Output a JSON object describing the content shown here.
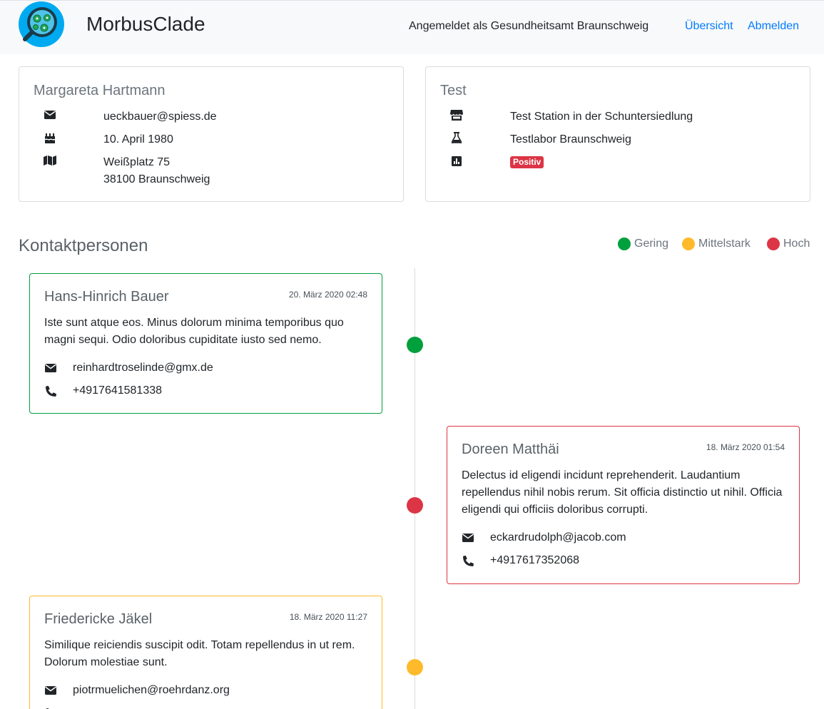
{
  "header": {
    "brand": "MorbusClade",
    "logged_in_text": "Angemeldet als Gesundheitsamt Braunschweig",
    "nav": {
      "overview": "Übersicht",
      "logout": "Abmelden"
    }
  },
  "colors": {
    "low": "#00a03c",
    "medium": "#ffba2b",
    "high": "#dc3545",
    "link": "#007bff"
  },
  "patient": {
    "name": "Margareta Hartmann",
    "email": "ueckbauer@spiess.de",
    "birthday": "10. April 1980",
    "address_line1": "Weißplatz 75",
    "address_line2": "38100 Braunschweig",
    "icons": {
      "email": "envelope-icon",
      "birthday": "birthday-cake-icon",
      "address": "map-icon"
    }
  },
  "test": {
    "title": "Test",
    "station": "Test Station in der Schuntersiedlung",
    "lab": "Testlabor Braunschweig",
    "result": "Positiv",
    "icons": {
      "station": "store-icon",
      "lab": "flask-icon",
      "result": "chart-icon"
    }
  },
  "contacts_section": {
    "title": "Kontaktpersonen",
    "legend": {
      "low": "Gering",
      "medium": "Mittelstark",
      "high": "Hoch"
    }
  },
  "contacts": [
    {
      "name": "Hans-Hinrich Bauer",
      "date": "20. März 2020 02:48",
      "description": "Iste sunt atque eos. Minus dolorum minima temporibus quo magni sequi. Odio doloribus cupiditate iusto sed nemo.",
      "email": "reinhardtroselinde@gmx.de",
      "phone": "+4917641581338",
      "risk": "low"
    },
    {
      "name": "Doreen Matthäi",
      "date": "18. März 2020 01:54",
      "description": "Delectus id eligendi incidunt reprehenderit. Laudantium repellendus nihil nobis rerum. Sit officia distinctio ut nihil. Officia eligendi qui officiis doloribus corrupti.",
      "email": "eckardrudolph@jacob.com",
      "phone": "+4917617352068",
      "risk": "high"
    },
    {
      "name": "Friedericke Jäkel",
      "date": "18. März 2020 11:27",
      "description": "Similique reiciendis suscipit odit. Totam repellendus in ut rem. Dolorum molestiae sunt.",
      "email": "piotrmuelichen@roehrdanz.org",
      "risk": "medium"
    }
  ]
}
